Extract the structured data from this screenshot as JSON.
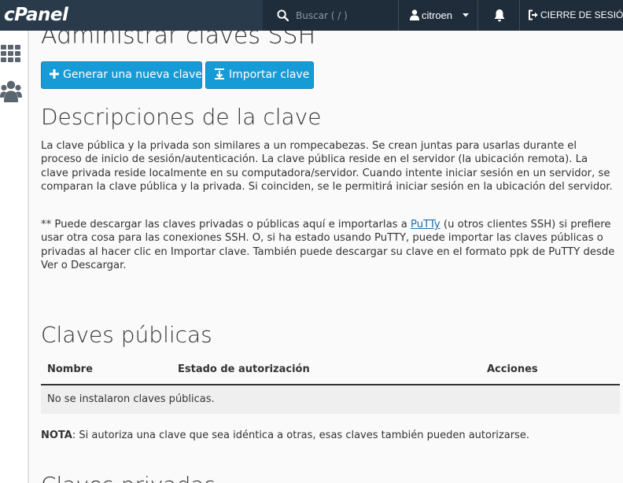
{
  "header": {
    "logo_text": "cPanel",
    "search_placeholder": "Buscar ( / )",
    "username": "citroen",
    "logout_label": "CIERRE DE SESIÓN"
  },
  "page": {
    "title": "Administrar claves SSH",
    "buttons": {
      "generate": "Generar una nueva clave",
      "import": "Importar clave"
    },
    "descriptions_heading": "Descripciones de la clave",
    "description_paragraph": "La clave pública y la privada son similares a un rompecabezas. Se crean juntas para usarlas durante el proceso de inicio de sesión/autenticación. La clave pública reside en el servidor (la ubicación remota). La clave privada reside localmente en su computadora/servidor. Cuando intente iniciar sesión en un servidor, se comparan la clave pública y la privada. Si coinciden, se le permitirá iniciar sesión en la ubicación del servidor.",
    "putty_paragraph_before": "** Puede descargar las claves privadas o públicas aquí e importarlas a ",
    "putty_link": "PuTTy",
    "putty_paragraph_after": " (u otros clientes SSH) si prefiere usar otra cosa para las conexiones SSH. O, si ha estado usando PuTTY, puede importar las claves públicas o privadas al hacer clic en Importar clave. También puede descargar su clave en el formato ppk de PuTTY desde Ver o Descargar.",
    "public_keys_heading": "Claves públicas",
    "table": {
      "columns": [
        "Nombre",
        "Estado de autorización",
        "Acciones"
      ],
      "empty_message": "No se instalaron claves públicas."
    },
    "note_label": "NOTA",
    "note_text": ": Si autoriza una clave que sea idéntica a otras, esas claves también pueden autorizarse.",
    "private_keys_heading": "Claves privadas"
  },
  "colors": {
    "topbar": "#293a4a",
    "topbar_dark": "#1f2d3a",
    "primary_button": "#179bd7",
    "link": "#1a6fb3"
  },
  "icons": [
    "search-icon",
    "user-icon",
    "caret-down-icon",
    "bell-icon",
    "logout-icon",
    "apps-grid-icon",
    "users-icon",
    "plus-icon",
    "import-icon"
  ]
}
